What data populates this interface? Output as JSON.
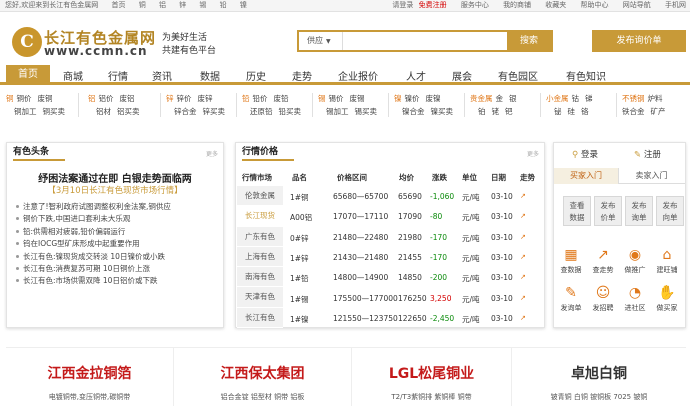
{
  "topbar": {
    "left": [
      "您好,欢迎来到长江有色金属网",
      "首页",
      "铜",
      "铝",
      "锌",
      "锡",
      "铅",
      "镍"
    ],
    "right": {
      "login": "请登录",
      "register": "免费注册",
      "service": "服务中心",
      "shop": "我的商铺",
      "favorites": "收藏夹",
      "help": "帮助中心",
      "sitemap": "网站导航",
      "mobile": "手机网"
    }
  },
  "header": {
    "logo_letter": "C",
    "logo_cn": "长江有色金属网",
    "logo_en": "www.ccmn.cn",
    "slogan1": "为美好生活",
    "slogan2": "共建有色平台",
    "search_select": "供应",
    "search_placeholder": "",
    "search_button": "搜索",
    "publish_button": "发布询价单"
  },
  "nav": [
    "首页",
    "商城",
    "行情",
    "资讯",
    "数据",
    "历史",
    "走势",
    "企业报价",
    "人才",
    "展会",
    "有色园区",
    "有色知识"
  ],
  "categories": [
    {
      "title": "铜",
      "row1": [
        "铜价",
        "废铜"
      ],
      "row2": [
        "铜加工",
        "铜买卖"
      ]
    },
    {
      "title": "铝",
      "row1": [
        "铝价",
        "废铝"
      ],
      "row2": [
        "铝材",
        "铝买卖"
      ]
    },
    {
      "title": "锌",
      "row1": [
        "锌价",
        "废锌"
      ],
      "row2": [
        "锌合金",
        "锌买卖"
      ]
    },
    {
      "title": "铅",
      "row1": [
        "铅价",
        "废铅"
      ],
      "row2": [
        "还原铅",
        "铅买卖"
      ]
    },
    {
      "title": "锡",
      "row1": [
        "锡价",
        "废锡"
      ],
      "row2": [
        "锡加工",
        "锡买卖"
      ]
    },
    {
      "title": "镍",
      "row1": [
        "镍价",
        "废镍"
      ],
      "row2": [
        "镍合金",
        "镍买卖"
      ]
    },
    {
      "title": "贵金属",
      "row1": [
        "金",
        "银"
      ],
      "row2": [
        "铂",
        "铑",
        "钯"
      ]
    },
    {
      "title": "小金属",
      "row1": [
        "钴",
        "锑"
      ],
      "row2": [
        "铋",
        "硅",
        "铬"
      ]
    },
    {
      "title": "不锈钢",
      "row1": [
        "炉料"
      ],
      "row2": [
        "铁合金",
        "矿产"
      ]
    }
  ],
  "news": {
    "title": "有色头条",
    "more": "更多",
    "headline": "纾困法案通过在即 白银走势面临两",
    "subhead": "【3月10日长江有色现货市场行情】",
    "items": [
      "注意了!智利政府试图调整权利金法案,铜供应",
      "铜价下跌,中国进口套利未大乐观",
      "铅:供需相对疲弱,铅价偏弱运行",
      "钨在IOCG型矿床形成中起重要作用",
      "长江有色:镍现货成交转淡 10日镍价或小跌",
      "长江有色:消费复苏可期 10日铜价上涨",
      "长江有色:市场供需双降 10日铝价或下跌"
    ]
  },
  "prices": {
    "title": "行情价格",
    "more": "更多",
    "headers": [
      "行情市场",
      "品名",
      "价格区间",
      "均价",
      "涨跌",
      "单位",
      "日期",
      "走势"
    ],
    "markets": [
      "伦敦金属",
      "长江现货",
      "广东有色",
      "上海有色",
      "南海有色",
      "天津有色",
      "长江有色"
    ],
    "active_market": 1,
    "rows": [
      {
        "name": "1#铜",
        "range": "65680—65700",
        "avg": "65690",
        "change": "-1,060",
        "dir": "down",
        "unit": "元/吨",
        "date": "03-10"
      },
      {
        "name": "A00铝",
        "range": "17070—17110",
        "avg": "17090",
        "change": "-80",
        "dir": "down",
        "unit": "元/吨",
        "date": "03-10"
      },
      {
        "name": "0#锌",
        "range": "21480—22480",
        "avg": "21980",
        "change": "-170",
        "dir": "down",
        "unit": "元/吨",
        "date": "03-10"
      },
      {
        "name": "1#锌",
        "range": "21430—21480",
        "avg": "21455",
        "change": "-170",
        "dir": "down",
        "unit": "元/吨",
        "date": "03-10"
      },
      {
        "name": "1#铅",
        "range": "14800—14900",
        "avg": "14850",
        "change": "-200",
        "dir": "down",
        "unit": "元/吨",
        "date": "03-10"
      },
      {
        "name": "1#锡",
        "range": "175500—177000",
        "avg": "176250",
        "change": "3,250",
        "dir": "up",
        "unit": "元/吨",
        "date": "03-10"
      },
      {
        "name": "1#镍",
        "range": "121550—123750",
        "avg": "122650",
        "change": "-2,450",
        "dir": "down",
        "unit": "元/吨",
        "date": "03-10"
      }
    ]
  },
  "user": {
    "login": "登录",
    "register": "注册",
    "tab_buyer": "买家入门",
    "tab_seller": "卖家入门",
    "buttons": [
      [
        "查看",
        "数据"
      ],
      [
        "发布",
        "价单"
      ],
      [
        "发布",
        "询单"
      ],
      [
        "发布",
        "向单"
      ]
    ],
    "icons": [
      {
        "label": "查数据",
        "icon": "calendar-icon",
        "glyph": "▦"
      },
      {
        "label": "查走势",
        "icon": "trend-icon",
        "glyph": "↗"
      },
      {
        "label": "做推广",
        "icon": "globe-icon",
        "glyph": "◉"
      },
      {
        "label": "建旺铺",
        "icon": "shop-icon",
        "glyph": "⌂"
      },
      {
        "label": "发询单",
        "icon": "edit-icon",
        "glyph": "✎"
      },
      {
        "label": "发招聘",
        "icon": "user-add-icon",
        "glyph": "☺"
      },
      {
        "label": "进社区",
        "icon": "chat-icon",
        "glyph": "◔"
      },
      {
        "label": "做买家",
        "icon": "handshake-icon",
        "glyph": "✋"
      }
    ]
  },
  "ads": [
    {
      "name": "江西金拉铜箔",
      "sub": "电镀铜带,变压铜带,碳铜带"
    },
    {
      "name": "江西保太集团",
      "sub": "铝合金锭 铝型材 铜带 铝板"
    },
    {
      "name": "LGL松尾铜业",
      "sub": "T2/T3紫铜排 紫铜棒 铜带"
    },
    {
      "name": "卓旭白铜",
      "sub": "铍青铜 白铜 铍铜板 7025 铍铜"
    }
  ]
}
